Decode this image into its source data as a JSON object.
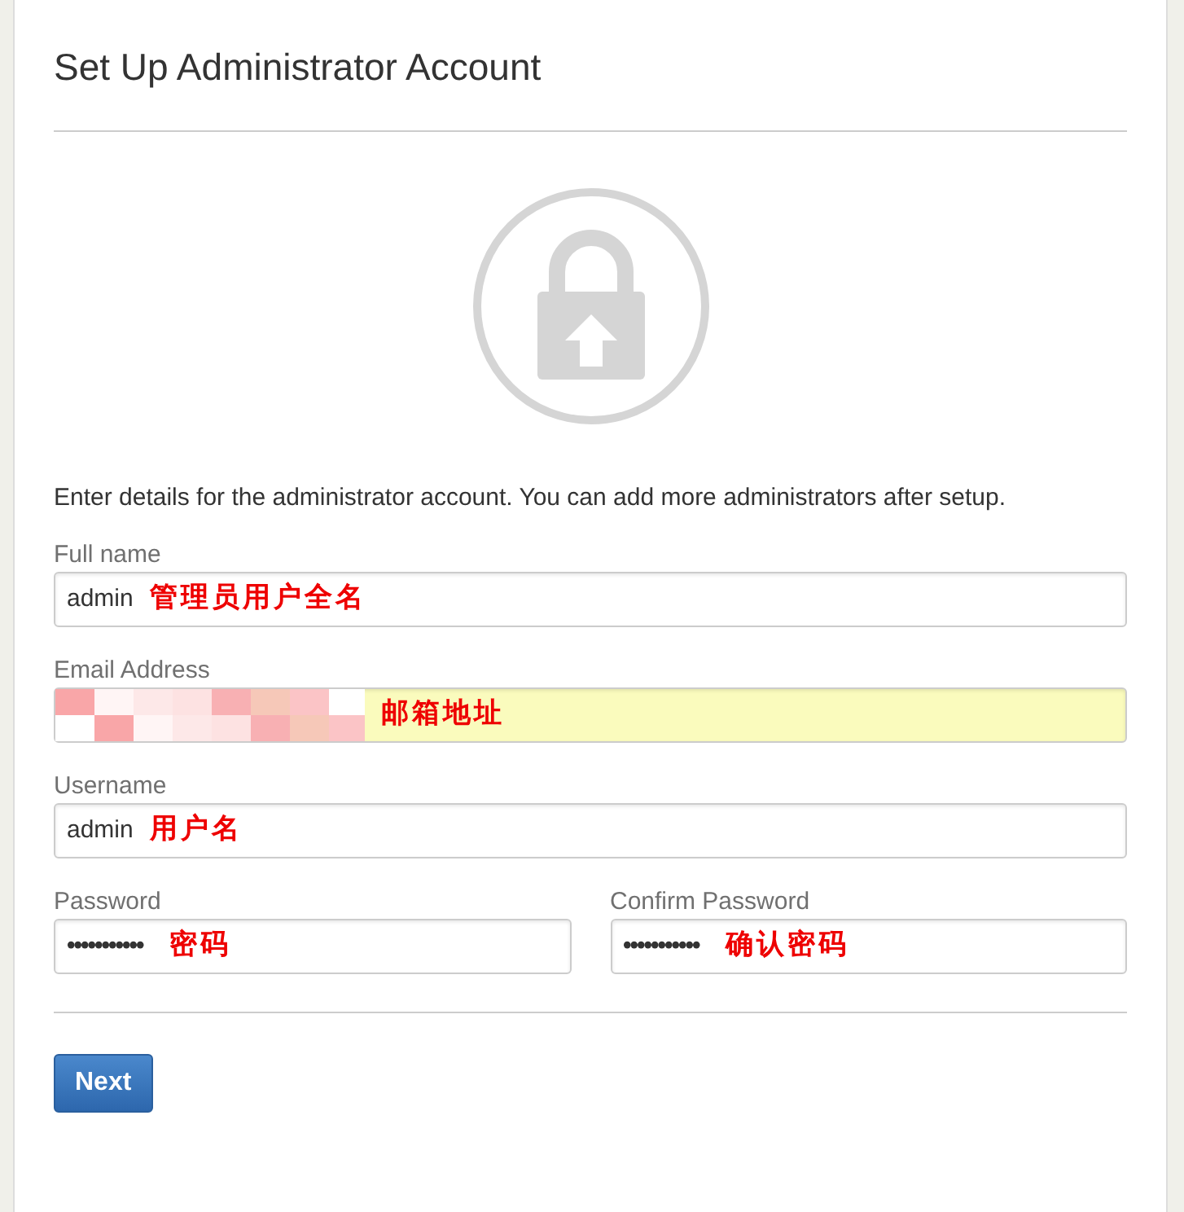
{
  "title": "Set Up Administrator Account",
  "intro": "Enter details for the administrator account. You can add more administrators after setup.",
  "field_rows": [
    [
      {
        "label": "Full name",
        "kind": "text",
        "value": "admin",
        "annotation": "管理员用户全名",
        "highlighted": false,
        "redacted": false
      }
    ],
    [
      {
        "label": "Email Address",
        "kind": "text",
        "annotation": "邮箱地址",
        "highlighted": true,
        "redacted": true
      }
    ],
    [
      {
        "label": "Username",
        "kind": "text",
        "value": "admin",
        "annotation": "用户名",
        "highlighted": false,
        "redacted": false
      }
    ],
    [
      {
        "label": "Password",
        "kind": "password",
        "value": "•••••••••••",
        "annotation": "密码",
        "highlighted": false,
        "redacted": false
      },
      {
        "label": "Confirm Password",
        "kind": "password",
        "value": "•••••••••••",
        "annotation": "确认密码",
        "highlighted": false,
        "redacted": false
      }
    ]
  ],
  "next_button": "Next"
}
